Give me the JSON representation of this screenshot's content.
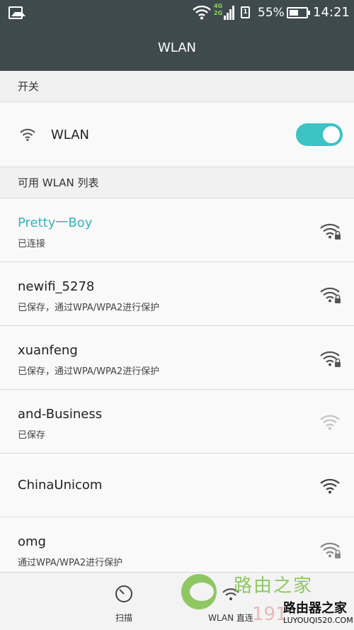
{
  "status_bar": {
    "network_badge_top": "4G",
    "network_badge_bottom": "2G",
    "battery_level": 0.55,
    "battery_text": "55%",
    "time": "14:21"
  },
  "title_bar": {
    "title": "WLAN"
  },
  "switch_section": {
    "header": "开关",
    "label": "WLAN",
    "enabled": true,
    "accent_color": "#3cc3c4"
  },
  "networks_section": {
    "header": "可用 WLAN 列表",
    "networks": [
      {
        "name": "Pretty一Boy",
        "status": "已连接",
        "connected": true
      },
      {
        "name": "newifi_5278",
        "status": "已保存，通过WPA/WPA2进行保护"
      },
      {
        "name": "xuanfeng",
        "status": "已保存，通过WPA/WPA2进行保护"
      },
      {
        "name": "and-Business",
        "status": "已保存"
      },
      {
        "name": "ChinaUnicom",
        "status": ""
      },
      {
        "name": "omg",
        "status": "通过WPA/WPA2进行保护"
      }
    ]
  },
  "bottom_bar": {
    "scan_label": "扫描",
    "direct_label": "WLAN 直连"
  },
  "watermark": {
    "brand": "路由之家",
    "number": "191",
    "tag": "路由器之家",
    "url": "LUYOUQI520.COM"
  },
  "colors": {
    "header_bg": "#3f4a4f",
    "connected_text": "#38b4be"
  }
}
